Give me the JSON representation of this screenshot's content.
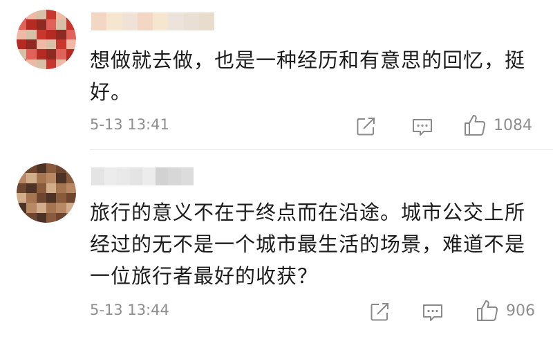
{
  "comments": [
    {
      "username": "",
      "text": "想做就去做，也是一种经历和有意思的回忆，挺好。",
      "time": "5-13 13:41",
      "likes": "1084",
      "avatar_palette": [
        "#c8362d",
        "#e0625a",
        "#f0b9a6",
        "#b52b24",
        "#d6c0a8",
        "#8f2a22"
      ],
      "username_palette": [
        "#f3d7c4",
        "#eadfd4",
        "#f6e6cf",
        "#e8dccc",
        "#f1e2d8",
        "#ece4da"
      ]
    },
    {
      "username": "",
      "text": "旅行的意义不在于终点而在沿途。城市公交上所经过的无不是一个城市最生活的场景，难道不是一位旅行者最好的收获？",
      "time": "5-13 13:44",
      "likes": "906",
      "avatar_palette": [
        "#8a5a3c",
        "#b88763",
        "#6e4630",
        "#d2ad8c",
        "#4d3325",
        "#a57450"
      ],
      "username_palette": [
        "#e4e4e4",
        "#d7d7d7",
        "#ececec",
        "#dcdcdc",
        "#e9e9e9",
        "#d2d2d2"
      ]
    }
  ],
  "icons": {
    "share": "share-icon",
    "reply": "comment-icon",
    "like": "thumbs-up-icon"
  }
}
